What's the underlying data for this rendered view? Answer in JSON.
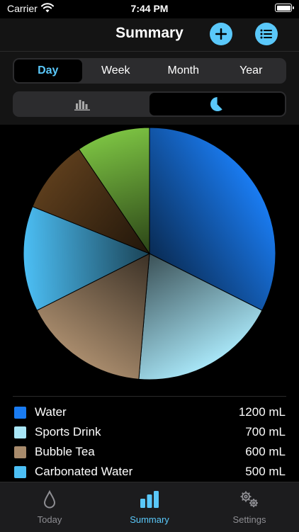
{
  "status_bar": {
    "carrier": "Carrier",
    "time": "7:44 PM"
  },
  "header": {
    "title": "Summary",
    "add_icon": "plus-icon",
    "list_icon": "list-icon"
  },
  "period_tabs": [
    {
      "label": "Day",
      "selected": true
    },
    {
      "label": "Week",
      "selected": false
    },
    {
      "label": "Month",
      "selected": false
    },
    {
      "label": "Year",
      "selected": false
    }
  ],
  "chart_toggle": {
    "options": [
      "bar-chart-icon",
      "pie-chart-icon"
    ],
    "selected": "pie-chart-icon"
  },
  "chart_data": {
    "type": "pie",
    "series": [
      {
        "name": "Water",
        "value": 1200,
        "color": "#1a7cf2"
      },
      {
        "name": "Sports Drink",
        "value": 700,
        "color": "#a8e6f7"
      },
      {
        "name": "Bubble Tea",
        "value": 600,
        "color": "#a88b6c"
      },
      {
        "name": "Carbonated Water",
        "value": 500,
        "color": "#4cbff5"
      },
      {
        "name": "",
        "value": 350,
        "color": "#5c3d1c"
      },
      {
        "name": "",
        "value": 350,
        "color": "#7bc142"
      }
    ]
  },
  "legend": [
    {
      "name": "Water",
      "amount": "1200 mL",
      "color": "#1a7cf2"
    },
    {
      "name": "Sports Drink",
      "amount": "700 mL",
      "color": "#a8e6f7"
    },
    {
      "name": "Bubble Tea",
      "amount": "600 mL",
      "color": "#a88b6c"
    },
    {
      "name": "Carbonated Water",
      "amount": "500 mL",
      "color": "#4cbff5"
    }
  ],
  "tab_bar": {
    "tabs": [
      {
        "label": "Today",
        "icon": "drop-icon",
        "active": false
      },
      {
        "label": "Summary",
        "icon": "bar-chart-icon",
        "active": true
      },
      {
        "label": "Settings",
        "icon": "gears-icon",
        "active": false
      }
    ]
  },
  "colors": {
    "accent": "#5ac8fa",
    "inactive": "#8e8e93"
  }
}
